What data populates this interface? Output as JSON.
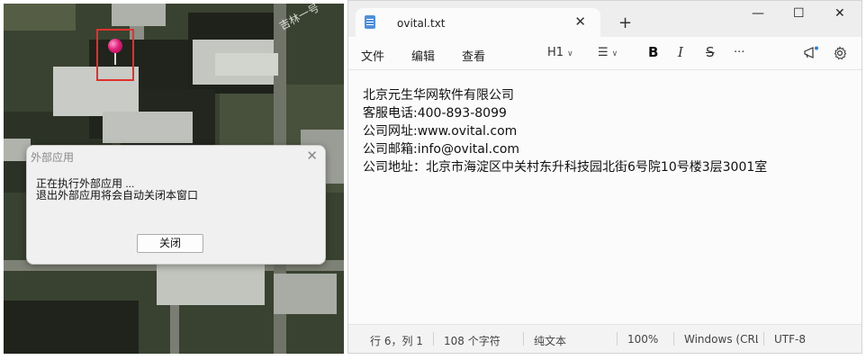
{
  "map": {
    "label": "吉林一号"
  },
  "dialog": {
    "title": "外部应用",
    "close_glyph": "✕",
    "message_line1": "正在执行外部应用 ...",
    "message_line2": "退出外部应用将会自动关闭本窗口",
    "button_label": "关闭"
  },
  "notepad": {
    "tab_title": "ovital.txt",
    "tab_close_glyph": "✕",
    "new_tab_glyph": "+",
    "window_controls": {
      "minimize": "—",
      "maximize": "☐",
      "close": "✕"
    },
    "menu": {
      "file": "文件",
      "edit": "编辑",
      "view": "查看"
    },
    "toolbar": {
      "heading": "H1",
      "list_glyph": "☰",
      "bold": "B",
      "italic": "I",
      "strike": "S",
      "more": "···",
      "chevron": "∨",
      "copilot_icon": "copilot-icon",
      "settings_icon": "gear-icon"
    },
    "lines": [
      "北京元生华网软件有限公司",
      "客服电话:400-893-8099",
      "公司网址:www.ovital.com",
      "公司邮箱:info@ovital.com",
      "公司地址：北京市海淀区中关村东升科技园北街6号院10号楼3层3001室"
    ],
    "status": {
      "position": "行 6，列 1",
      "char_count": "108 个字符",
      "format": "纯文本",
      "zoom": "100%",
      "line_ending": "Windows (CRLF",
      "encoding": "UTF-8"
    }
  }
}
